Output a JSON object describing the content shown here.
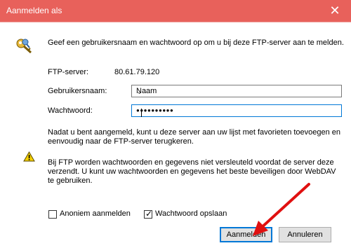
{
  "window": {
    "title": "Aanmelden als",
    "close_glyph": "✕"
  },
  "intro_text": "Geef een gebruikersnaam en wachtwoord op om u bij deze FTP-server aan te melden.",
  "ftp_server": {
    "label": "FTP-server:",
    "value": "80.61.79.120"
  },
  "username": {
    "label": "Gebruikersnaam:",
    "value": "Naam"
  },
  "password": {
    "label": "Wachtwoord:",
    "masked_value": "●●●●●●●●●●"
  },
  "info_text": "Nadat u bent aangemeld, kunt u deze server aan uw lijst met favorieten toevoegen en eenvoudig naar de FTP-server terugkeren.",
  "warning_text": "Bij FTP worden wachtwoorden en gegevens niet versleuteld voordat de server deze verzendt. U kunt uw wachtwoorden en gegevens het beste beveiligen door WebDAV te gebruiken.",
  "anonymous": {
    "label": "Anoniem aanmelden",
    "checked": false
  },
  "save_password": {
    "label": "Wachtwoord opslaan",
    "checked": true
  },
  "buttons": {
    "login": "Aanmelden",
    "cancel": "Annuleren"
  },
  "colors": {
    "titlebar": "#e8615b",
    "accent": "#0078d7",
    "arrow": "#e01010"
  },
  "icons": {
    "keys": "keys-icon",
    "warning": "warning-icon",
    "close": "close-icon",
    "dropdown": "chevron-down-icon"
  }
}
